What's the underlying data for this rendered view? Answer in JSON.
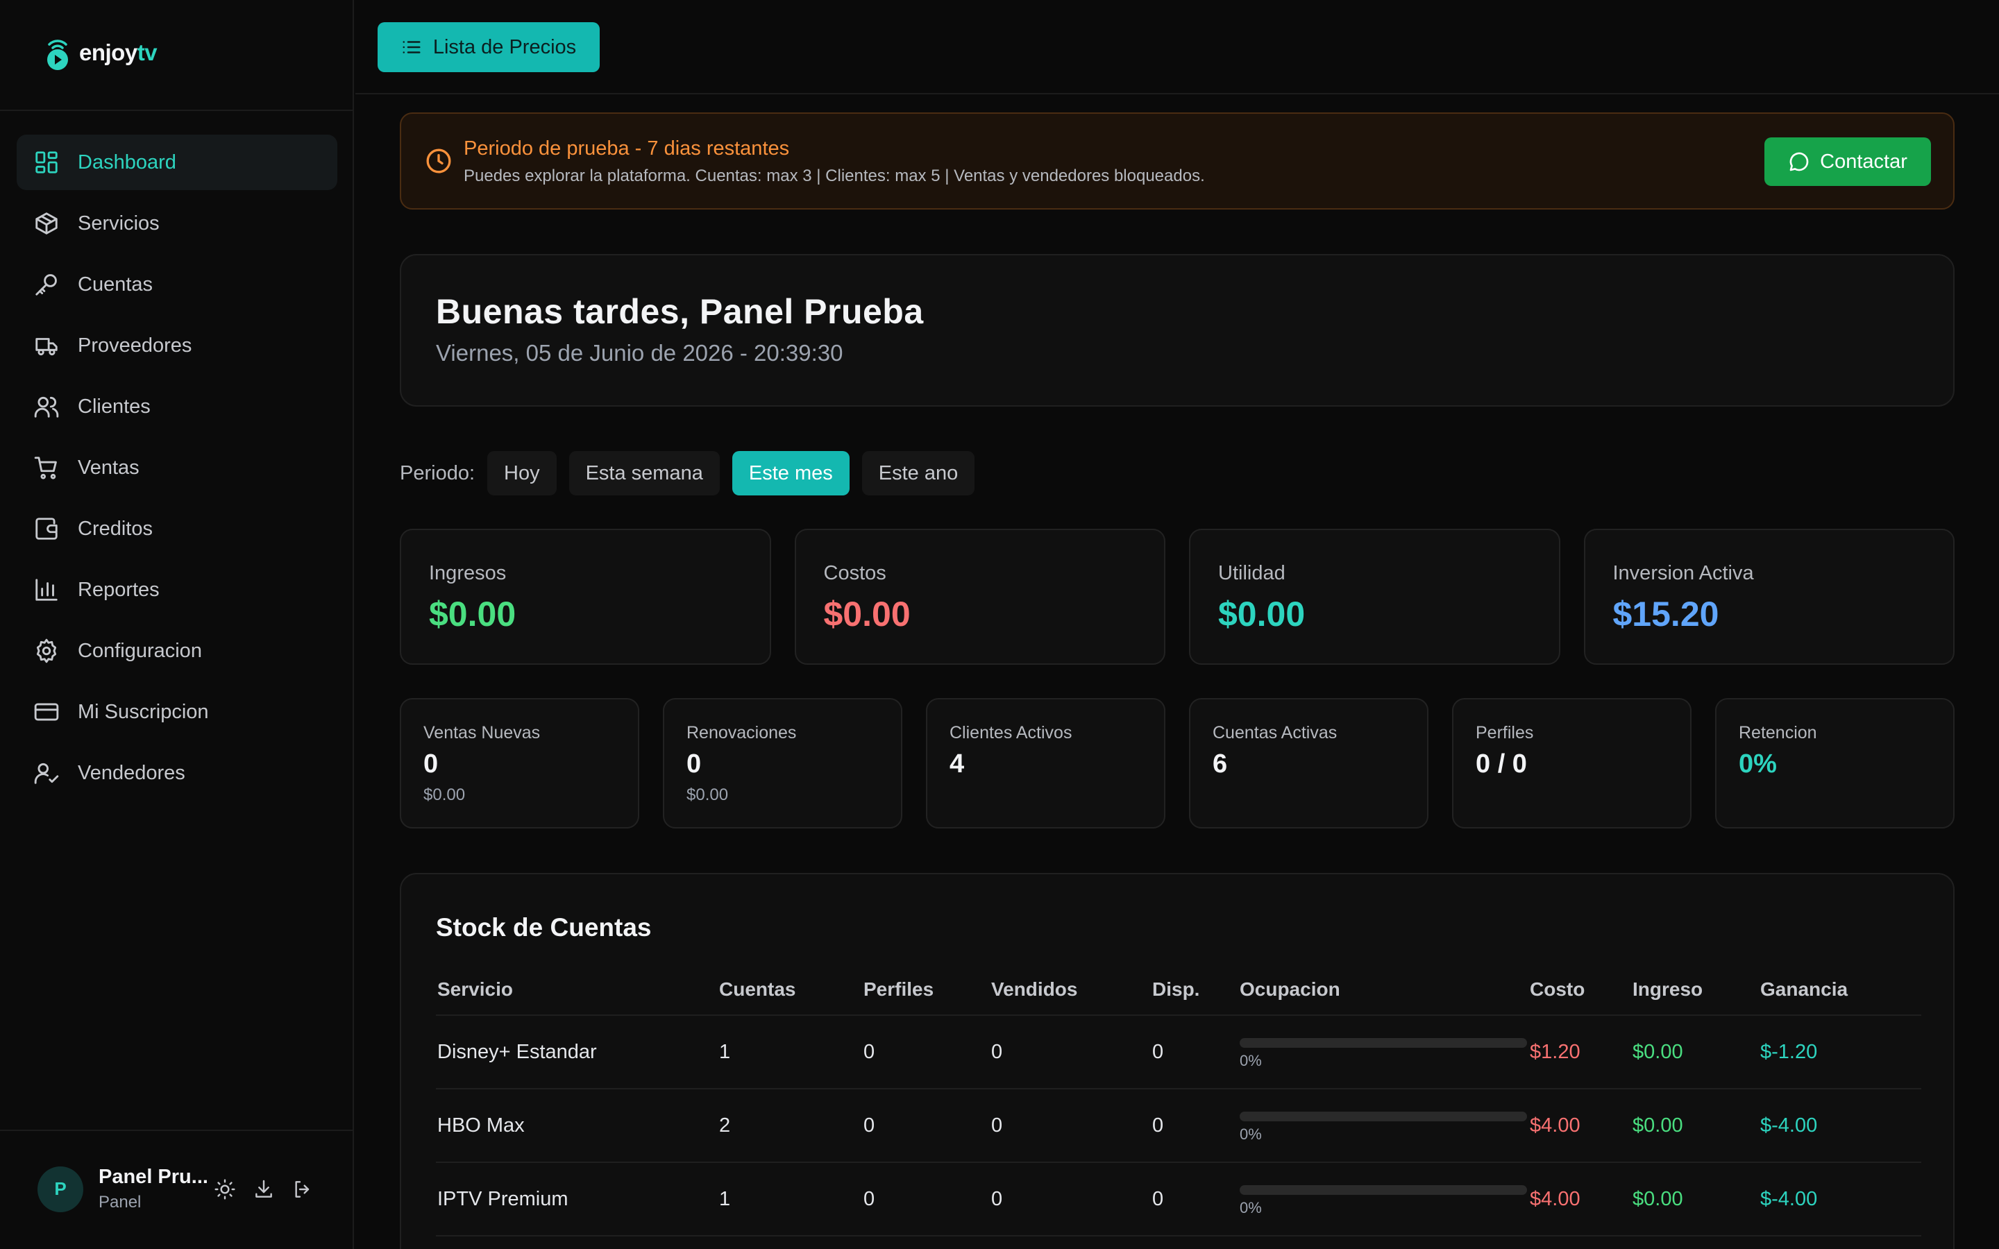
{
  "brand": {
    "name_part1": "enjoy",
    "name_part2": "tv"
  },
  "sidebar": {
    "items": [
      {
        "label": "Dashboard",
        "icon": "dashboard-icon",
        "active": true
      },
      {
        "label": "Servicios",
        "icon": "box-icon"
      },
      {
        "label": "Cuentas",
        "icon": "key-icon"
      },
      {
        "label": "Proveedores",
        "icon": "truck-icon"
      },
      {
        "label": "Clientes",
        "icon": "users-icon"
      },
      {
        "label": "Ventas",
        "icon": "cart-icon"
      },
      {
        "label": "Creditos",
        "icon": "wallet-icon"
      },
      {
        "label": "Reportes",
        "icon": "bar-chart-icon"
      },
      {
        "label": "Configuracion",
        "icon": "gear-icon"
      },
      {
        "label": "Mi Suscripcion",
        "icon": "credit-card-icon"
      },
      {
        "label": "Vendedores",
        "icon": "user-check-icon"
      }
    ]
  },
  "user": {
    "initial": "P",
    "name": "Panel Pru...",
    "role": "Panel"
  },
  "topbar": {
    "price_list_label": "Lista de Precios"
  },
  "trial": {
    "title": "Periodo de prueba - 7 dias restantes",
    "description": "Puedes explorar la plataforma. Cuentas: max 3 | Clientes: max 5 | Ventas y vendedores bloqueados.",
    "contact_label": "Contactar"
  },
  "greeting": {
    "title": "Buenas tardes, Panel Prueba",
    "date": "Viernes, 05 de Junio de 2026 - 20:39:30"
  },
  "period": {
    "label": "Periodo:",
    "options": [
      "Hoy",
      "Esta semana",
      "Este mes",
      "Este ano"
    ],
    "selected": "Este mes"
  },
  "kpis": [
    {
      "label": "Ingresos",
      "value": "$0.00",
      "color": "#4ade80"
    },
    {
      "label": "Costos",
      "value": "$0.00",
      "color": "#f87171"
    },
    {
      "label": "Utilidad",
      "value": "$0.00",
      "color": "#2dd4bf"
    },
    {
      "label": "Inversion Activa",
      "value": "$15.20",
      "color": "#60a5fa"
    }
  ],
  "stats": [
    {
      "label": "Ventas Nuevas",
      "value": "0",
      "sub": "$0.00"
    },
    {
      "label": "Renovaciones",
      "value": "0",
      "sub": "$0.00"
    },
    {
      "label": "Clientes Activos",
      "value": "4",
      "sub": ""
    },
    {
      "label": "Cuentas Activas",
      "value": "6",
      "sub": ""
    },
    {
      "label": "Perfiles",
      "value": "0 / 0",
      "sub": ""
    },
    {
      "label": "Retencion",
      "value": "0%",
      "sub": ""
    }
  ],
  "stock": {
    "title": "Stock de Cuentas",
    "columns": [
      "Servicio",
      "Cuentas",
      "Perfiles",
      "Vendidos",
      "Disp.",
      "Ocupacion",
      "Costo",
      "Ingreso",
      "Ganancia"
    ],
    "rows": [
      {
        "servicio": "Disney+ Estandar",
        "cuentas": "1",
        "perfiles": "0",
        "vendidos": "0",
        "disp": "0",
        "ocupacion": "0%",
        "ocupacion_level": 0,
        "costo": "$1.20",
        "ingreso": "$0.00",
        "ganancia": "$-1.20"
      },
      {
        "servicio": "HBO Max",
        "cuentas": "2",
        "perfiles": "0",
        "vendidos": "0",
        "disp": "0",
        "ocupacion": "0%",
        "ocupacion_level": 0,
        "costo": "$4.00",
        "ingreso": "$0.00",
        "ganancia": "$-4.00"
      },
      {
        "servicio": "IPTV Premium",
        "cuentas": "1",
        "perfiles": "0",
        "vendidos": "0",
        "disp": "0",
        "ocupacion": "0%",
        "ocupacion_level": 0,
        "costo": "$4.00",
        "ingreso": "$0.00",
        "ganancia": "$-4.00"
      }
    ]
  },
  "colors": {
    "accent": "#14b8b0",
    "accent_text": "#2dd4bf",
    "warning": "#fb923c",
    "success_button": "#16a34a"
  }
}
